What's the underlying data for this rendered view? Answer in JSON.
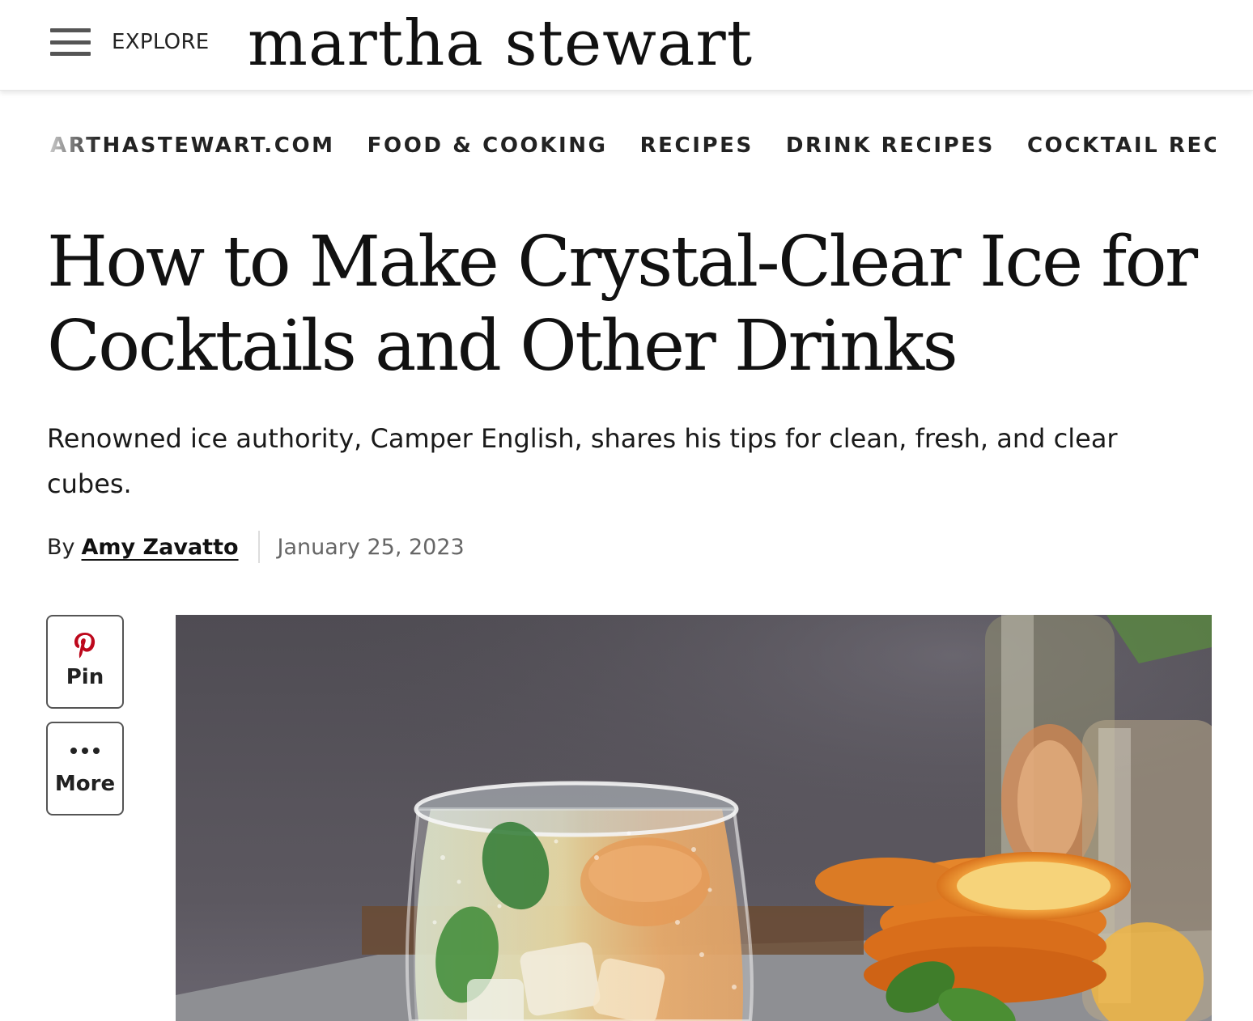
{
  "header": {
    "explore_label": "EXPLORE",
    "logo_text": "martha stewart"
  },
  "breadcrumb": [
    "ARTHASTEWART.COM",
    "FOOD & COOKING",
    "RECIPES",
    "DRINK RECIPES",
    "COCKTAIL RECIPES"
  ],
  "article": {
    "title": "How to Make Crystal-Clear Ice for Cocktails and Other Drinks",
    "dek": "Renowned ice authority, Camper English, shares his tips for clean, fresh, and clear cubes.",
    "byline_prefix": "By",
    "author": "Amy Zavatto",
    "date": "January 25, 2023"
  },
  "social": {
    "pin_label": "Pin",
    "more_label": "More"
  },
  "colors": {
    "pinterest": "#bd081c",
    "text": "#111111",
    "muted": "#666666"
  }
}
